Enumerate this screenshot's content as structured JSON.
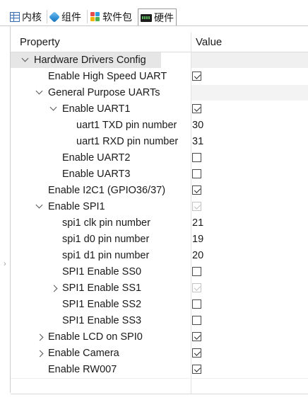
{
  "tabs": [
    {
      "label": "内核",
      "icon": "table-icon"
    },
    {
      "label": "组件",
      "icon": "cube-icon"
    },
    {
      "label": "软件包",
      "icon": "package-icon"
    },
    {
      "label": "硬件",
      "icon": "hardware-board-icon",
      "active": true
    }
  ],
  "table": {
    "col_property": "Property",
    "col_value": "Value"
  },
  "rows": [
    {
      "label": "Hardware Drivers Config",
      "expand": "expanded"
    },
    {
      "label": "Enable High Speed UART",
      "checked": true
    },
    {
      "label": "General Purpose UARTs",
      "expand": "expanded"
    },
    {
      "label": "Enable UART1",
      "expand": "expanded",
      "checked": true
    },
    {
      "label": "uart1 TXD pin number",
      "value": "30"
    },
    {
      "label": "uart1 RXD pin number",
      "value": "31"
    },
    {
      "label": "Enable UART2",
      "checked": false
    },
    {
      "label": "Enable UART3",
      "checked": false
    },
    {
      "label": "Enable I2C1 (GPIO36/37)",
      "checked": true
    },
    {
      "label": "Enable SPI1",
      "expand": "expanded",
      "checked": true,
      "disabled": true
    },
    {
      "label": "spi1 clk pin number",
      "value": "21"
    },
    {
      "label": "spi1 d0 pin number",
      "value": "19"
    },
    {
      "label": "spi1 d1 pin number",
      "value": "20"
    },
    {
      "label": "SPI1 Enable SS0",
      "checked": false
    },
    {
      "label": "SPI1 Enable SS1",
      "expand": "collapsed",
      "checked": true,
      "disabled": true
    },
    {
      "label": "SPI1 Enable SS2",
      "checked": false
    },
    {
      "label": "SPI1 Enable SS3",
      "checked": false
    },
    {
      "label": "Enable LCD on SPI0",
      "expand": "collapsed",
      "checked": true
    },
    {
      "label": "Enable Camera",
      "expand": "collapsed",
      "checked": true
    },
    {
      "label": "Enable RW007",
      "checked": true
    }
  ]
}
